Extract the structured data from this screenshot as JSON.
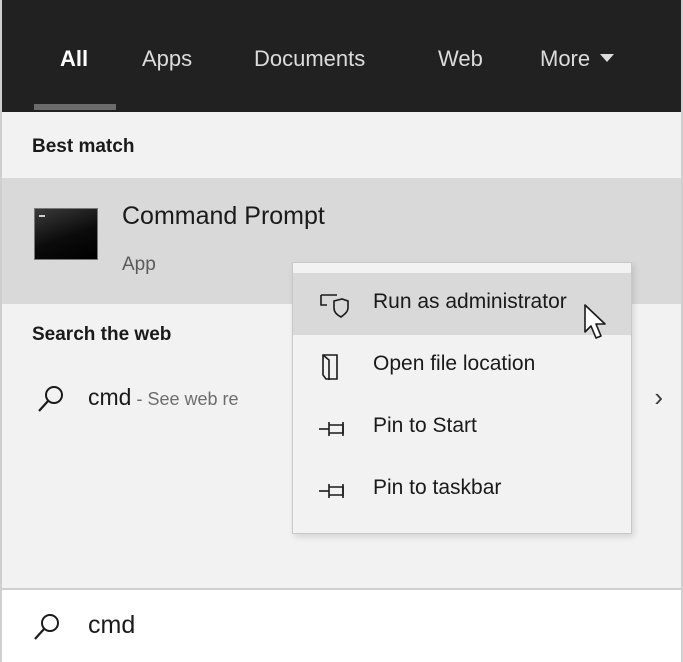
{
  "tabs": [
    {
      "label": "All",
      "active": true
    },
    {
      "label": "Apps",
      "active": false
    },
    {
      "label": "Documents",
      "active": false
    },
    {
      "label": "Web",
      "active": false
    },
    {
      "label": "More",
      "active": false
    }
  ],
  "best_match": {
    "header": "Best match",
    "app_name": "Command Prompt",
    "app_type": "App",
    "icon": "command-prompt-icon"
  },
  "web": {
    "header": "Search the web",
    "query": "cmd",
    "separator": " - ",
    "hint": "See web re",
    "icon": "search-icon"
  },
  "context_menu": {
    "items": [
      {
        "label": "Run as administrator",
        "icon": "run-as-admin-shield-icon",
        "highlighted": true
      },
      {
        "label": "Open file location",
        "icon": "open-file-location-icon",
        "highlighted": false
      },
      {
        "label": "Pin to Start",
        "icon": "pin-icon",
        "highlighted": false
      },
      {
        "label": "Pin to taskbar",
        "icon": "pin-icon",
        "highlighted": false
      }
    ]
  },
  "search_box": {
    "value": "cmd",
    "icon": "search-icon"
  },
  "colors": {
    "tabbar_bg": "#212121",
    "panel_bg": "#f2f2f2",
    "highlight": "#d9d9d9"
  }
}
